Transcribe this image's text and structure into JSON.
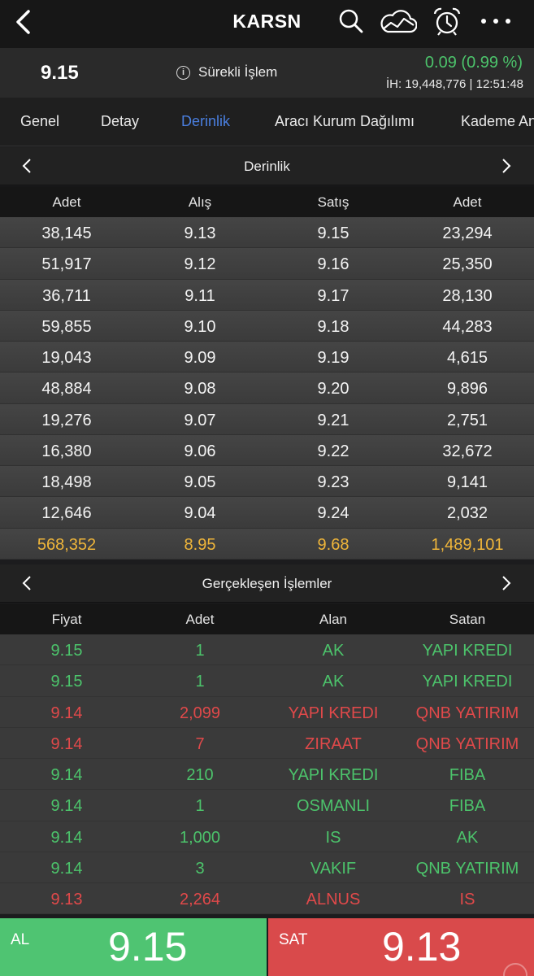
{
  "header": {
    "title": "KARSN",
    "icons": [
      "back-chevron-icon",
      "search-icon",
      "cloud-chart-icon",
      "alarm-clock-icon",
      "more-icon"
    ]
  },
  "price": {
    "last": "9.15",
    "session": "Sürekli İşlem",
    "change": "0.09 (0.99 %)",
    "volume": "İH:  19,448,776 | 12:51:48"
  },
  "tabs": [
    {
      "label": "Genel"
    },
    {
      "label": "Detay"
    },
    {
      "label": "Derinlik",
      "active": true
    },
    {
      "label": "Aracı Kurum Dağılımı"
    },
    {
      "label": "Kademe Analizi"
    }
  ],
  "depth": {
    "title": "Derinlik",
    "headers": [
      "Adet",
      "Alış",
      "Satış",
      "Adet"
    ],
    "rows": [
      [
        "38,145",
        "9.13",
        "9.15",
        "23,294"
      ],
      [
        "51,917",
        "9.12",
        "9.16",
        "25,350"
      ],
      [
        "36,711",
        "9.11",
        "9.17",
        "28,130"
      ],
      [
        "59,855",
        "9.10",
        "9.18",
        "44,283"
      ],
      [
        "19,043",
        "9.09",
        "9.19",
        "4,615"
      ],
      [
        "48,884",
        "9.08",
        "9.20",
        "9,896"
      ],
      [
        "19,276",
        "9.07",
        "9.21",
        "2,751"
      ],
      [
        "16,380",
        "9.06",
        "9.22",
        "32,672"
      ],
      [
        "18,498",
        "9.05",
        "9.23",
        "9,141"
      ],
      [
        "12,646",
        "9.04",
        "9.24",
        "2,032"
      ]
    ],
    "total": [
      "568,352",
      "8.95",
      "9.68",
      "1,489,101"
    ]
  },
  "trades": {
    "title": "Gerçekleşen İşlemler",
    "headers": [
      "Fiyat",
      "Adet",
      "Alan",
      "Satan"
    ],
    "rows": [
      {
        "side": "up",
        "cells": [
          "9.15",
          "1",
          "AK",
          "YAPI KREDI"
        ]
      },
      {
        "side": "up",
        "cells": [
          "9.15",
          "1",
          "AK",
          "YAPI KREDI"
        ]
      },
      {
        "side": "down",
        "cells": [
          "9.14",
          "2,099",
          "YAPI KREDI",
          "QNB YATIRIM"
        ]
      },
      {
        "side": "down",
        "cells": [
          "9.14",
          "7",
          "ZIRAAT",
          "QNB YATIRIM"
        ]
      },
      {
        "side": "up",
        "cells": [
          "9.14",
          "210",
          "YAPI KREDI",
          "FIBA"
        ]
      },
      {
        "side": "up",
        "cells": [
          "9.14",
          "1",
          "OSMANLI",
          "FIBA"
        ]
      },
      {
        "side": "up",
        "cells": [
          "9.14",
          "1,000",
          "IS",
          "AK"
        ]
      },
      {
        "side": "up",
        "cells": [
          "9.14",
          "3",
          "VAKIF",
          "QNB YATIRIM"
        ]
      },
      {
        "side": "down",
        "cells": [
          "9.13",
          "2,264",
          "ALNUS",
          "IS"
        ]
      }
    ]
  },
  "actions": {
    "buy_label": "AL",
    "buy_price": "9.15",
    "sell_label": "SAT",
    "sell_price": "9.13"
  },
  "colors": {
    "up": "#4cc36b",
    "down": "#e0494a",
    "total": "#f0b63a",
    "active_tab": "#4a7fe0"
  }
}
